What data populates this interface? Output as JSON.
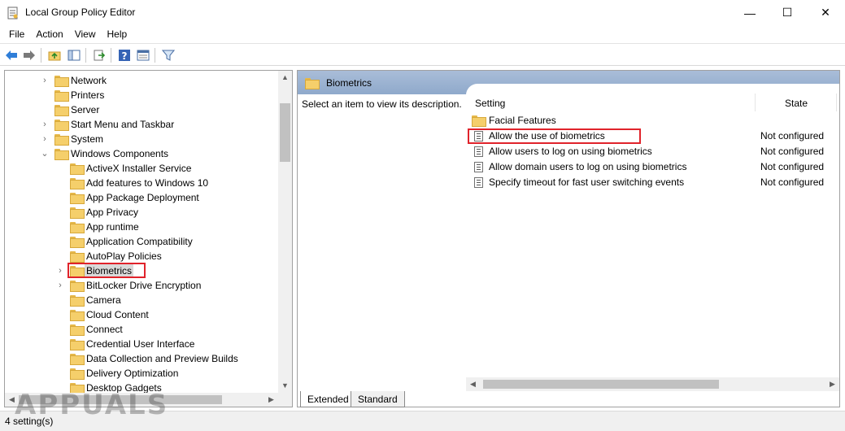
{
  "window": {
    "title": "Local Group Policy Editor",
    "minimize": "—",
    "maximize": "☐",
    "close": "✕"
  },
  "menu": [
    "File",
    "Action",
    "View",
    "Help"
  ],
  "toolbar": [
    "back-arrow-icon",
    "forward-arrow-icon",
    "up-folder-icon",
    "show-hide-tree-icon",
    "export-list-icon",
    "help-icon",
    "properties-icon",
    "filter-icon"
  ],
  "tree": {
    "items": [
      {
        "label": "Network",
        "expandable": true,
        "level": 1
      },
      {
        "label": "Printers",
        "expandable": false,
        "level": 1
      },
      {
        "label": "Server",
        "expandable": false,
        "level": 1
      },
      {
        "label": "Start Menu and Taskbar",
        "expandable": true,
        "level": 1
      },
      {
        "label": "System",
        "expandable": true,
        "level": 1
      },
      {
        "label": "Windows Components",
        "expandable": true,
        "expanded": true,
        "level": 1
      },
      {
        "label": "ActiveX Installer Service",
        "expandable": false,
        "level": 2
      },
      {
        "label": "Add features to Windows 10",
        "expandable": false,
        "level": 2
      },
      {
        "label": "App Package Deployment",
        "expandable": false,
        "level": 2
      },
      {
        "label": "App Privacy",
        "expandable": false,
        "level": 2
      },
      {
        "label": "App runtime",
        "expandable": false,
        "level": 2
      },
      {
        "label": "Application Compatibility",
        "expandable": false,
        "level": 2
      },
      {
        "label": "AutoPlay Policies",
        "expandable": false,
        "level": 2
      },
      {
        "label": "Biometrics",
        "expandable": true,
        "level": 2,
        "selected": true
      },
      {
        "label": "BitLocker Drive Encryption",
        "expandable": true,
        "level": 2
      },
      {
        "label": "Camera",
        "expandable": false,
        "level": 2
      },
      {
        "label": "Cloud Content",
        "expandable": false,
        "level": 2
      },
      {
        "label": "Connect",
        "expandable": false,
        "level": 2
      },
      {
        "label": "Credential User Interface",
        "expandable": false,
        "level": 2
      },
      {
        "label": "Data Collection and Preview Builds",
        "expandable": false,
        "level": 2
      },
      {
        "label": "Delivery Optimization",
        "expandable": false,
        "level": 2
      },
      {
        "label": "Desktop Gadgets",
        "expandable": false,
        "level": 2
      }
    ]
  },
  "details": {
    "header_title": "Biometrics",
    "description": "Select an item to view its description.",
    "columns": {
      "setting": "Setting",
      "state": "State"
    },
    "rows": [
      {
        "label": "Facial Features",
        "state": "",
        "type": "folder"
      },
      {
        "label": "Allow the use of biometrics",
        "state": "Not configured",
        "type": "setting",
        "highlighted": true
      },
      {
        "label": "Allow users to log on using biometrics",
        "state": "Not configured",
        "type": "setting"
      },
      {
        "label": "Allow domain users to log on using biometrics",
        "state": "Not configured",
        "type": "setting"
      },
      {
        "label": "Specify timeout for fast user switching events",
        "state": "Not configured",
        "type": "setting"
      }
    ]
  },
  "tabs": [
    "Extended",
    "Standard"
  ],
  "status": "4 setting(s)",
  "watermark": "APPUALS",
  "colors": {
    "highlight_box": "#e0232b",
    "header_gradient": "#a9bdd8",
    "folder": "#f5cf6b"
  }
}
